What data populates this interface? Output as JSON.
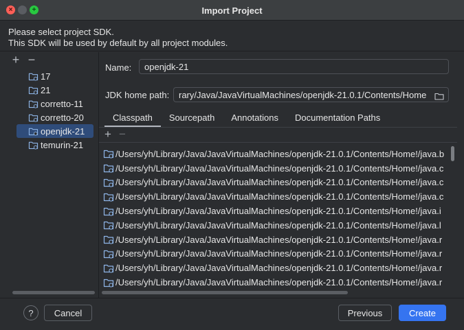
{
  "window": {
    "title": "Import Project"
  },
  "description": {
    "line1": "Please select project SDK.",
    "line2": "This SDK will be used by default by all project modules."
  },
  "sdk_toolbar": {
    "add": "+",
    "remove": "−"
  },
  "sdk_list": [
    {
      "label": "17"
    },
    {
      "label": "21"
    },
    {
      "label": "corretto-11"
    },
    {
      "label": "corretto-20"
    },
    {
      "label": "openjdk-21",
      "selected": true
    },
    {
      "label": "temurin-21"
    }
  ],
  "form": {
    "name_label": "Name:",
    "name_value": "openjdk-21",
    "home_label": "JDK home path:",
    "home_value": "rary/Java/JavaVirtualMachines/openjdk-21.0.1/Contents/Home"
  },
  "tabs": [
    {
      "label": "Classpath",
      "active": true
    },
    {
      "label": "Sourcepath"
    },
    {
      "label": "Annotations"
    },
    {
      "label": "Documentation Paths"
    }
  ],
  "classpath_toolbar": {
    "add": "+",
    "remove": "−"
  },
  "classpath_entries": [
    "/Users/yh/Library/Java/JavaVirtualMachines/openjdk-21.0.1/Contents/Home!/java.b",
    "/Users/yh/Library/Java/JavaVirtualMachines/openjdk-21.0.1/Contents/Home!/java.c",
    "/Users/yh/Library/Java/JavaVirtualMachines/openjdk-21.0.1/Contents/Home!/java.c",
    "/Users/yh/Library/Java/JavaVirtualMachines/openjdk-21.0.1/Contents/Home!/java.c",
    "/Users/yh/Library/Java/JavaVirtualMachines/openjdk-21.0.1/Contents/Home!/java.i",
    "/Users/yh/Library/Java/JavaVirtualMachines/openjdk-21.0.1/Contents/Home!/java.l",
    "/Users/yh/Library/Java/JavaVirtualMachines/openjdk-21.0.1/Contents/Home!/java.r",
    "/Users/yh/Library/Java/JavaVirtualMachines/openjdk-21.0.1/Contents/Home!/java.r",
    "/Users/yh/Library/Java/JavaVirtualMachines/openjdk-21.0.1/Contents/Home!/java.r",
    "/Users/yh/Library/Java/JavaVirtualMachines/openjdk-21.0.1/Contents/Home!/java.r"
  ],
  "footer": {
    "help": "?",
    "cancel": "Cancel",
    "previous": "Previous",
    "create": "Create"
  },
  "colors": {
    "background": "#2b2d30",
    "selection": "#2f4c7a",
    "primary_button": "#3574f0"
  },
  "icons": {
    "close": "close-icon",
    "folder": "folder-icon",
    "browse": "browse-folder-icon",
    "help": "help-icon"
  }
}
